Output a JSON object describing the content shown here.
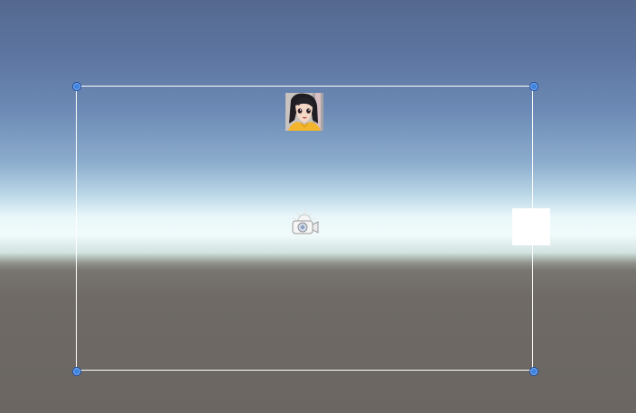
{
  "scene_view": {
    "gizmos": {
      "rect_handles": [
        "top-left",
        "top-right",
        "bottom-left",
        "bottom-right"
      ],
      "sprite_icon": "anime-girl-sprite",
      "camera_icon": "camera-light-gizmo-icon",
      "white_quad": "white-square"
    },
    "colors": {
      "frame": "#ffffff",
      "handle": "#3d84e0",
      "sky_top": "#55698f",
      "horizon": "#f1fbfb",
      "ground": "#6b6662"
    }
  }
}
